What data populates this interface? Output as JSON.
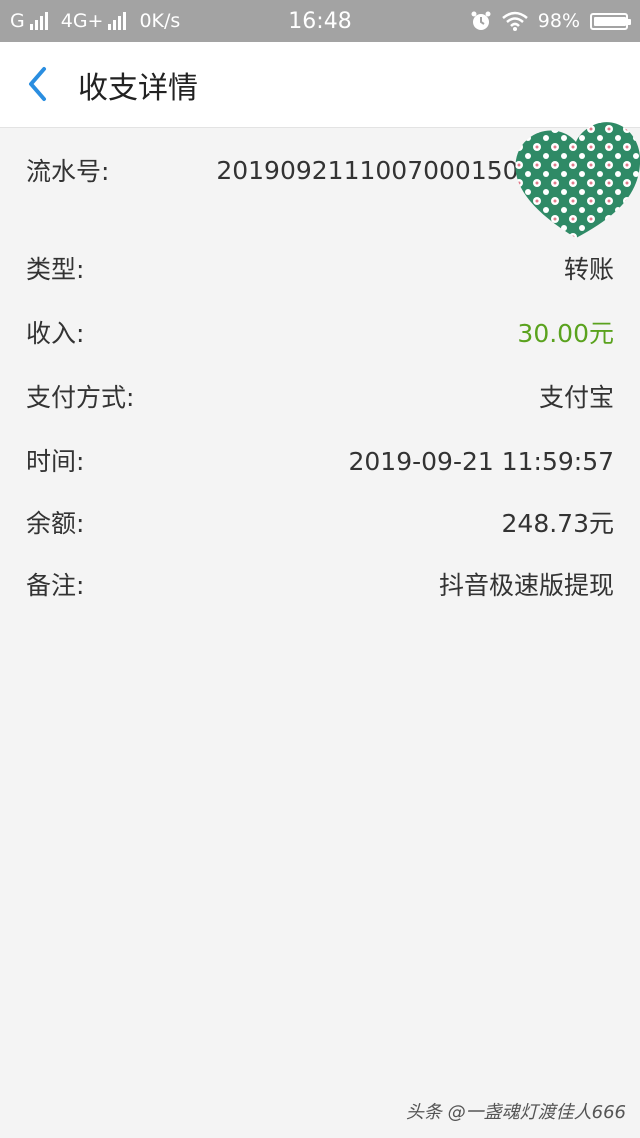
{
  "status_bar": {
    "carrier1": "G",
    "network": "4G+",
    "speed": "0K/s",
    "time": "16:48",
    "battery": "98%",
    "alarm_icon": "alarm-clock-icon",
    "wifi_icon": "wifi-icon"
  },
  "header": {
    "title": "收支详情",
    "back_icon": "chevron-left-icon"
  },
  "details": [
    {
      "label": "流水号:",
      "value": "20190921110070001501551559"
    },
    {
      "label": "类型:",
      "value": "转账"
    },
    {
      "label": "收入:",
      "value": "30.00元"
    },
    {
      "label": "支付方式:",
      "value": "支付宝"
    },
    {
      "label": "时间:",
      "value": "2019-09-21 11:59:57"
    },
    {
      "label": "余额:",
      "value": "248.73元"
    },
    {
      "label": "备注:",
      "value": "抖音极速版提现"
    }
  ],
  "colors": {
    "income": "#5aa21e",
    "accent_back": "#2a8ee0",
    "status_bar_bg": "#a3a3a3",
    "sticker": "#2f8a66"
  },
  "watermark": "头条 @一盏魂灯渡佳人666"
}
